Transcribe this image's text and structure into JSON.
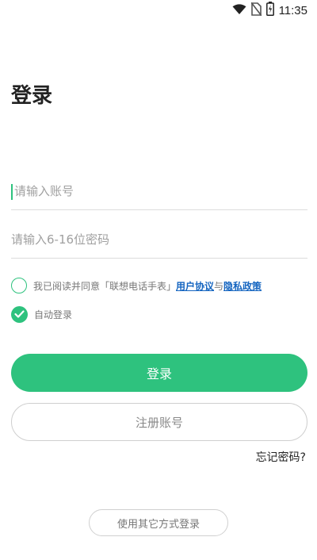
{
  "status_bar": {
    "time": "11:35",
    "icons": [
      "wifi-icon",
      "no-sim-icon",
      "battery-charging-icon"
    ]
  },
  "login": {
    "title": "登录",
    "account_placeholder": "请输入账号",
    "password_placeholder": "请输入6-16位密码",
    "agreement_prefix": "我已阅读并同意「联想电话手表」",
    "user_agreement_link": "用户协议",
    "agreement_joiner": "与",
    "privacy_policy_link": "隐私政策",
    "auto_login_label": "自动登录",
    "login_button": "登录",
    "register_button": "注册账号",
    "forgot_password": "忘记密码?",
    "other_login_button": "使用其它方式登录"
  },
  "colors": {
    "accent": "#2ec27e",
    "link": "#1565c0"
  }
}
